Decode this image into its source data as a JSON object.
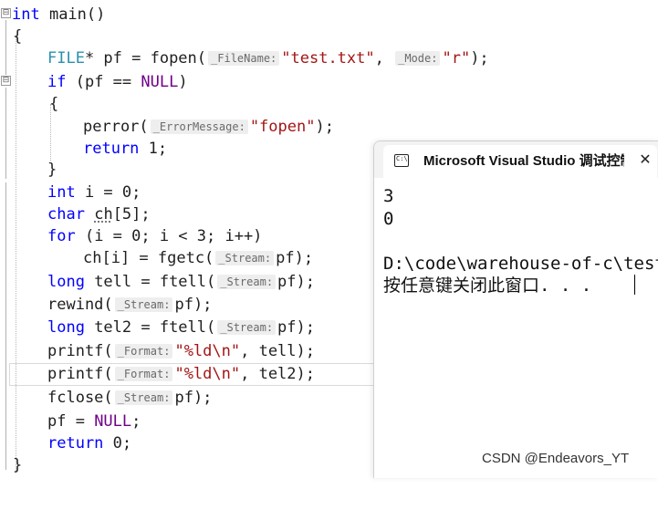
{
  "editor": {
    "fold_collapse_symbol": "⊟",
    "lines": [
      {
        "kind": "main_sig",
        "kw": "int",
        "rest": " main()"
      },
      {
        "kind": "text",
        "text": "{"
      },
      {
        "kind": "file_decl",
        "type": "FILE",
        "mid": "* pf = fopen(",
        "hint1": "_FileName:",
        "str1": "\"test.txt\"",
        "sep": ", ",
        "hint2": "_Mode:",
        "str2": "\"r\"",
        "end": ");"
      },
      {
        "kind": "if_line",
        "kw": "if",
        "mid": " (pf == ",
        "macro": "NULL",
        "end": ")"
      },
      {
        "kind": "text",
        "text": "{"
      },
      {
        "kind": "perror_line",
        "fn": "perror(",
        "hint": "_ErrorMessage:",
        "str": "\"fopen\"",
        "end": ");"
      },
      {
        "kind": "return1",
        "kw": "return",
        "rest": " 1;"
      },
      {
        "kind": "text",
        "text": "}"
      },
      {
        "kind": "decl_i",
        "kw": "int",
        "rest": " i = 0;"
      },
      {
        "kind": "decl_ch",
        "kw": "char",
        "name": "ch",
        "rest": "[5];"
      },
      {
        "kind": "for_line",
        "kw": "for",
        "rest": " (i = 0; i < 3; i++)"
      },
      {
        "kind": "fgetc_line",
        "pre": "ch[i] = fgetc(",
        "hint": "_Stream:",
        "arg": "pf",
        "end": ");"
      },
      {
        "kind": "ftell1",
        "kw": "long",
        "pre": " tell = ftell(",
        "hint": "_Stream:",
        "arg": "pf",
        "end": ");"
      },
      {
        "kind": "rewind_line",
        "pre": "rewind(",
        "hint": "_Stream:",
        "arg": "pf",
        "end": ");"
      },
      {
        "kind": "ftell2",
        "kw": "long",
        "pre": " tel2 = ftell(",
        "hint": "_Stream:",
        "arg": "pf",
        "end": ");"
      },
      {
        "kind": "printf1",
        "pre": "printf(",
        "hint": "_Format:",
        "str": "\"%ld\\n\"",
        "end": ", tell);"
      },
      {
        "kind": "printf2",
        "pre": "printf(",
        "hint": "_Format:",
        "str": "\"%ld\\n\"",
        "end": ", tel2);"
      },
      {
        "kind": "fclose_line",
        "pre": "fclose(",
        "hint": "_Stream:",
        "arg": "pf",
        "end": ");"
      },
      {
        "kind": "pf_null",
        "pre": "pf = ",
        "macro": "NULL",
        "end": ";"
      },
      {
        "kind": "return0",
        "kw": "return",
        "rest": " 0;"
      },
      {
        "kind": "text",
        "text": "}"
      }
    ]
  },
  "console": {
    "tab_title": "Microsoft Visual Studio 调试控制台",
    "icon_text": "C:\\",
    "close_glyph": "✕",
    "output_lines": [
      "3",
      "0",
      "",
      "D:\\code\\warehouse-of-c\\test",
      "按任意键关闭此窗口. . ."
    ]
  },
  "watermark": "CSDN @Endeavors_YT"
}
